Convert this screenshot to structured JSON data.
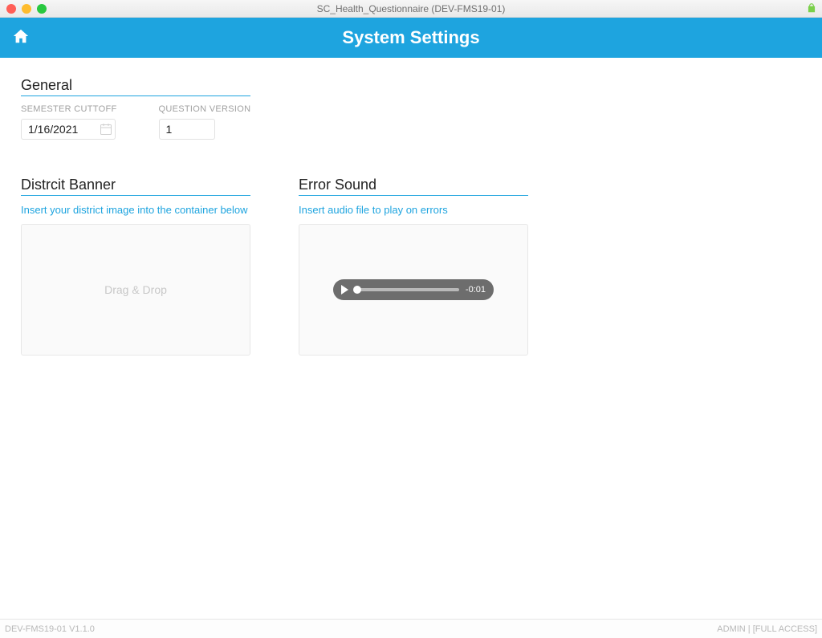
{
  "window": {
    "title": "SC_Health_Questionnaire (DEV-FMS19-01)"
  },
  "header": {
    "title": "System Settings"
  },
  "general": {
    "section_title": "General",
    "semester_cutoff": {
      "label": "SEMESTER CUTTOFF",
      "value": "1/16/2021"
    },
    "question_version": {
      "label": "QUESTION VERSION",
      "value": "1"
    }
  },
  "district_banner": {
    "section_title": "Distrcit Banner",
    "help": "Insert your district image into the container below",
    "placeholder": "Drag & Drop"
  },
  "error_sound": {
    "section_title": "Error Sound",
    "help": "Insert audio file to play on errors",
    "time_remaining": "-0:01"
  },
  "footer": {
    "left": "DEV-FMS19-01 V1.1.0",
    "right": "ADMIN | [FULL ACCESS]"
  }
}
